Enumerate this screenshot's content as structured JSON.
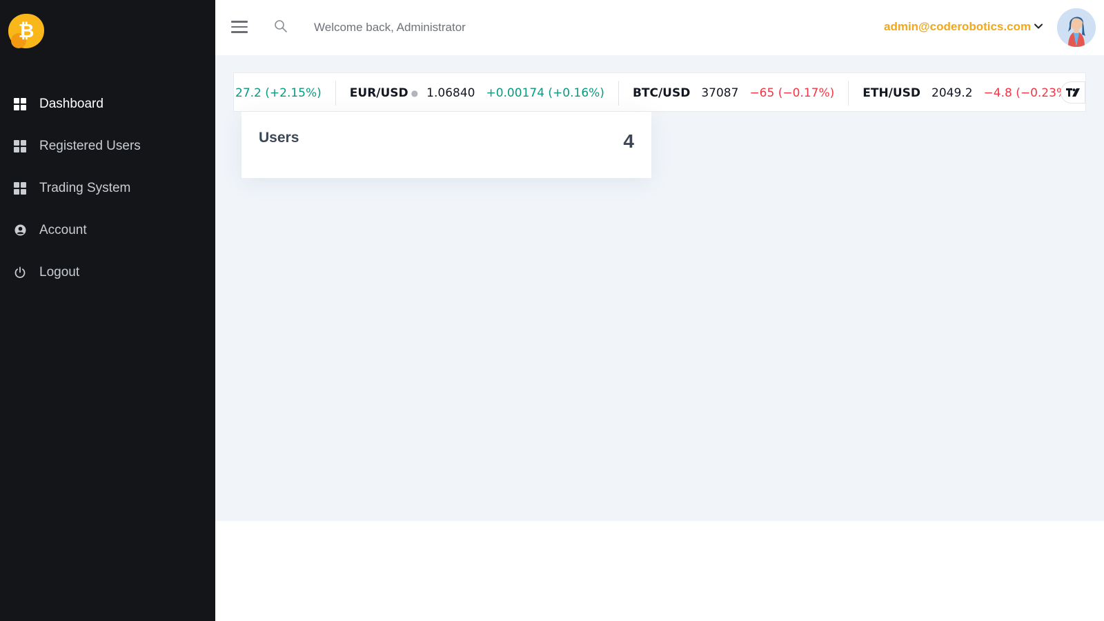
{
  "brand": {
    "logo_icon": "bitcoin-icon",
    "logo_symbol": "₿",
    "accent": "#f9b71a"
  },
  "sidebar": {
    "items": [
      {
        "label": "Dashboard",
        "icon": "grid-icon",
        "active": true
      },
      {
        "label": "Registered Users",
        "icon": "grid-icon",
        "active": false
      },
      {
        "label": "Trading System",
        "icon": "grid-icon",
        "active": false
      },
      {
        "label": "Account",
        "icon": "user-circle-icon",
        "active": false
      },
      {
        "label": "Logout",
        "icon": "power-icon",
        "active": false
      }
    ]
  },
  "header": {
    "welcome": "Welcome back, Administrator",
    "email": "admin@coderobotics.com",
    "email_color": "#f0a81c"
  },
  "ticker": {
    "items": [
      {
        "symbol": "",
        "price": "",
        "change": "27.2 (+2.15%)",
        "direction": "up"
      },
      {
        "symbol": "EUR/USD",
        "price": "1.06840",
        "change": "+0.00174 (+0.16%)",
        "direction": "up"
      },
      {
        "symbol": "BTC/USD",
        "price": "37087",
        "change": "−65 (−0.17%)",
        "direction": "down"
      },
      {
        "symbol": "ETH/USD",
        "price": "2049.2",
        "change": "−4.8 (−0.23%)",
        "direction": "down"
      }
    ],
    "widget_badge": "TV",
    "up_color": "#089981",
    "down_color": "#f23645"
  },
  "stats_card": {
    "title": "Users",
    "value": "4"
  }
}
